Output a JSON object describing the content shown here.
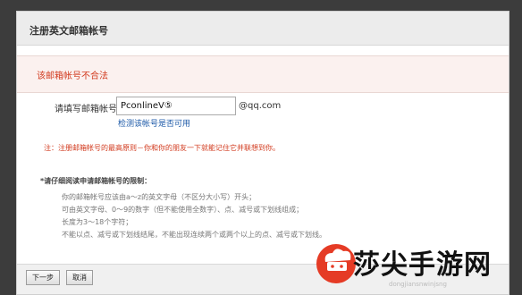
{
  "header": {
    "title": "注册英文邮箱帐号"
  },
  "error": {
    "message": "该邮箱帐号不合法"
  },
  "form": {
    "email_label": "请填写邮箱帐号：",
    "email_value": "PconlineV⑤",
    "email_suffix": "@qq.com",
    "check_link": "检测该帐号是否可用",
    "note": "注：注册邮箱帐号的最高原则－你和你的朋友一下就能记住它并联想到你。"
  },
  "rules": {
    "title": "*请仔细阅读申请邮箱帐号的限制：",
    "items": [
      "你的邮箱帐号应该由a～z的英文字母（不区分大小写）开头；",
      "可由英文字母、0～9的数字（但不能使用全数字）、点、减号或下划线组成；",
      "长度为3～18个字符；",
      "不能以点、减号或下划线结尾，不能出现连续两个或两个以上的点、减号或下划线。"
    ]
  },
  "buttons": {
    "next": "下一步",
    "cancel": "取消"
  },
  "watermark": {
    "text": "莎尖手游网",
    "url": "dongjiansnwinjsng"
  },
  "colors": {
    "error": "#d23b1f",
    "link": "#1d5aa8",
    "header_bg": "#ececec"
  }
}
